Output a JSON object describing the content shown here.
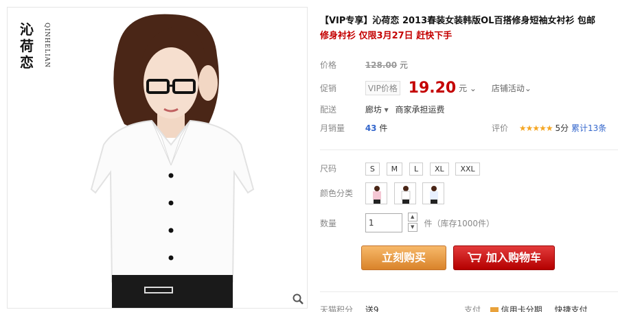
{
  "brand": {
    "name_cn": "沁荷恋",
    "name_pinyin": "QINHELIAN"
  },
  "product": {
    "title": "【VIP专享】沁荷恋 2013春装女装韩版OL百搭修身短袖女衬衫 包邮",
    "subtitle": "修身衬衫 仅限3月27日 赶快下手"
  },
  "pricing": {
    "list_label": "价格",
    "list_price": "128.00",
    "currency_unit": "元",
    "promo_label": "促销",
    "vip_tag": "VIP价格",
    "promo_price": "19.20",
    "promo_unit": "元",
    "store_activity": "店铺活动"
  },
  "shipping": {
    "label": "配送",
    "origin": "廊坊",
    "fee_note": "商家承担运费"
  },
  "sales": {
    "label": "月销量",
    "count": "43",
    "unit": "件",
    "rating_label": "评价",
    "stars": "★★★★★",
    "score": "5分",
    "reviews": "累计13条"
  },
  "options": {
    "size_label": "尺码",
    "sizes": [
      "S",
      "M",
      "L",
      "XL",
      "XXL"
    ],
    "color_label": "颜色分类",
    "quantity_label": "数量",
    "quantity_value": "1",
    "stock_note": "件（库存1000件）"
  },
  "actions": {
    "buy_now": "立刻购买",
    "add_to_cart": "加入购物车"
  },
  "footer_row": {
    "points_label": "天猫积分",
    "points_value": "送9",
    "pay_label": "支付",
    "credit_pay": "信用卡分期",
    "quick_pay": "快捷支付"
  },
  "colors": {
    "price_red": "#c40000",
    "buy_orange": "#e89a45",
    "cart_red": "#c80000",
    "link_blue": "#3366cc"
  },
  "icons": [
    "zoom-icon",
    "cart-icon",
    "chevron-down-icon",
    "card-icon"
  ]
}
